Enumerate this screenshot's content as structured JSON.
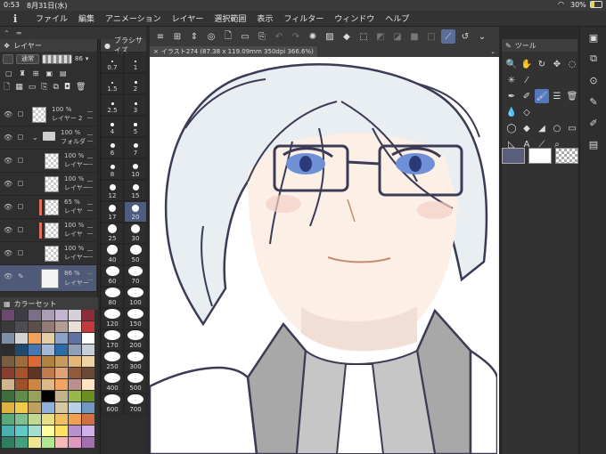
{
  "status_bar": {
    "time": "0:53",
    "date": "8月31日(水)",
    "battery": "30%"
  },
  "menu": [
    "ファイル",
    "編集",
    "アニメーション",
    "レイヤー",
    "選択範囲",
    "表示",
    "フィルター",
    "ウィンドウ",
    "ヘルプ"
  ],
  "layer_panel": {
    "title": "レイヤー",
    "blend_mode": "通常",
    "opacity": "86",
    "layers": [
      {
        "opacity": "100 %",
        "name": "レイヤー 2"
      },
      {
        "opacity": "100 %",
        "name": "フォルダ"
      },
      {
        "opacity": "100 %",
        "name": "レイヤー"
      },
      {
        "opacity": "100 %",
        "name": "レイヤー"
      },
      {
        "opacity": "65 %",
        "name": "レイヤ"
      },
      {
        "opacity": "100 %",
        "name": "レイヤ"
      },
      {
        "opacity": "100 %",
        "name": "レイヤー"
      },
      {
        "opacity": "86 %",
        "name": "レイヤー"
      }
    ]
  },
  "palette_panel": {
    "title": "カラーセット",
    "colors": [
      "#6b4a6e",
      "#3d3d45",
      "#7c6e86",
      "#a89fb4",
      "#c6b5d2",
      "#d6d0da",
      "#8a2c3a",
      "#3a3a3a",
      "#4c4c52",
      "#5c4e4a",
      "#927a76",
      "#b29c95",
      "#e8dfd8",
      "#c23a3f",
      "#7e8fa8",
      "#d4d4d4",
      "#f2a35a",
      "#e4cfa6",
      "#8ca3c8",
      "#5f72a3",
      "#ffffff",
      "#2d2d2d",
      "#1e4a72",
      "#4677b0",
      "#a3b9d6",
      "#2a6ba8",
      "#8e9fb7",
      "#c7cfd9",
      "#7a5c3e",
      "#9c6e3b",
      "#d96a35",
      "#b0823e",
      "#c89b5e",
      "#e2b779",
      "#efd3a2",
      "#8a3d2c",
      "#a8542a",
      "#603322",
      "#c07a4d",
      "#e1a275",
      "#8e5c3c",
      "#6a4a36",
      "#d2b48c",
      "#a0522d",
      "#cd853f",
      "#deb887",
      "#f4a460",
      "#bc8f8f",
      "#ffe4c4",
      "#3c6e3c",
      "#5e8e4a",
      "#9aa05a",
      "#000000",
      "#c4b28c",
      "#98b84c",
      "#6b8e23",
      "#e0b040",
      "#f2c94c",
      "#c0a060",
      "#8fb0d8",
      "#d8c8a0",
      "#b8d0e8",
      "#7098c0",
      "#58a878",
      "#80c090",
      "#c0d890",
      "#e8e080",
      "#f0c060",
      "#f0a050",
      "#d07040",
      "#48b0b0",
      "#60c8c8",
      "#a0e0d0",
      "#ffffa0",
      "#ffe060",
      "#b890d0",
      "#d0b0e8",
      "#2c8060",
      "#40a080",
      "#f0e890",
      "#b0e890",
      "#f8b8b8",
      "#e098c0",
      "#a070b0"
    ]
  },
  "brush_panel": {
    "title": "ブラシサイズ",
    "sizes": [
      "0.7",
      "1",
      "1.5",
      "2",
      "2.5",
      "3",
      "4",
      "5",
      "6",
      "7",
      "8",
      "10",
      "12",
      "15",
      "17",
      "20",
      "25",
      "30",
      "40",
      "50",
      "60",
      "70",
      "80",
      "100",
      "120",
      "150",
      "170",
      "200",
      "250",
      "300",
      "400",
      "500",
      "600",
      "700"
    ],
    "selected": "20"
  },
  "document": {
    "tab": "イラスト274 (87.38 x 119.09mm 350dpi 366.6%)"
  },
  "tool_panel": {
    "title": "ツール"
  },
  "colors": {
    "main": "#5a5e7a",
    "sub": "#ffffff",
    "accent": "#5577bb"
  }
}
